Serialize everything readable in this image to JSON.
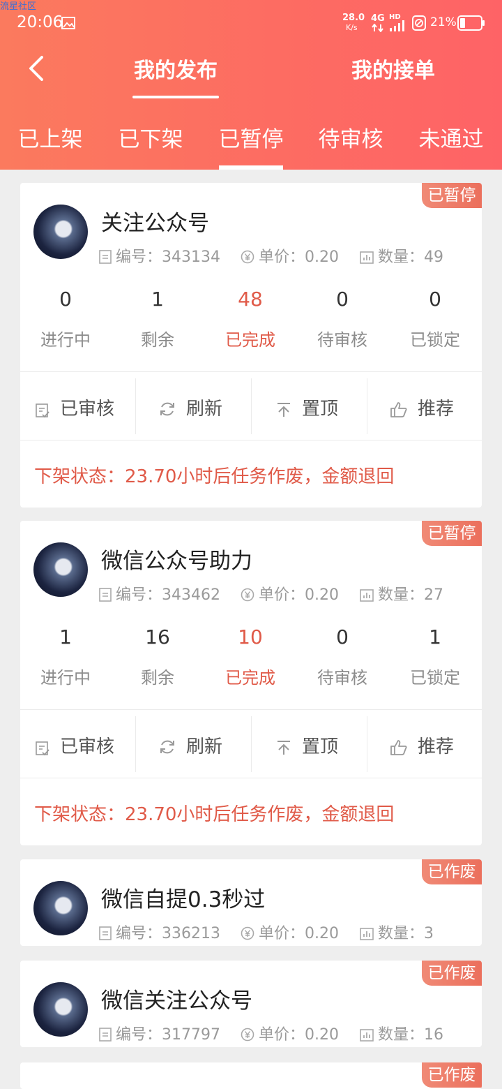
{
  "watermark": "流星社区",
  "status_bar": {
    "time": "20:06",
    "net_speed": "28.0",
    "net_unit": "K/s",
    "signal_label": "4G",
    "hd_label": "HD",
    "battery": "21%"
  },
  "tabs": {
    "my_publish": "我的发布",
    "my_orders": "我的接单"
  },
  "subtabs": [
    "已上架",
    "已下架",
    "已暂停",
    "待审核",
    "未通过"
  ],
  "labels": {
    "id": "编号：",
    "price": "单价：",
    "count": "数量："
  },
  "stat_labels": [
    "进行中",
    "剩余",
    "已完成",
    "待审核",
    "已锁定"
  ],
  "actions": {
    "audited": "已审核",
    "refresh": "刷新",
    "top": "置顶",
    "recommend": "推荐"
  },
  "cards": [
    {
      "badge": "已暂停",
      "title": "关注公众号",
      "id": "343134",
      "price": "0.20",
      "count": "49",
      "stats": [
        "0",
        "1",
        "48",
        "0",
        "0"
      ],
      "status": "下架状态：23.70小时后任务作废，金额退回"
    },
    {
      "badge": "已暂停",
      "title": "微信公众号助力",
      "id": "343462",
      "price": "0.20",
      "count": "27",
      "stats": [
        "1",
        "16",
        "10",
        "0",
        "1"
      ],
      "status": "下架状态：23.70小时后任务作废，金额退回"
    },
    {
      "badge": "已作废",
      "title": "微信自提0.3秒过",
      "id": "336213",
      "price": "0.20",
      "count": "3"
    },
    {
      "badge": "已作废",
      "title": "微信关注公众号",
      "id": "317797",
      "price": "0.20",
      "count": "16"
    },
    {
      "badge": "已作废"
    }
  ],
  "colors": {
    "header_start": "#fb7a5e",
    "header_end": "#fe6366",
    "accent_red": "#e05a48"
  }
}
